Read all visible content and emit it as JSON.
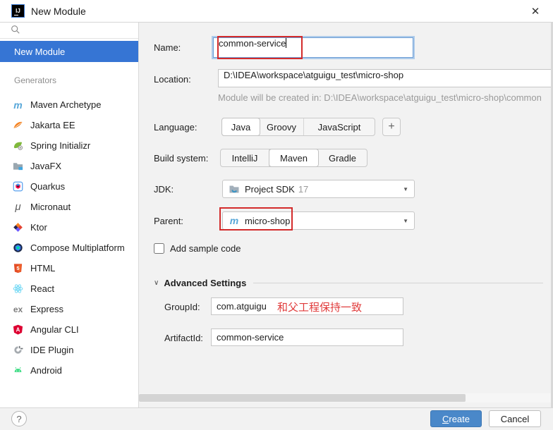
{
  "window": {
    "title": "New Module",
    "logo_text": "IJ",
    "close_glyph": "✕"
  },
  "icons": {
    "dropdown_arrow": "▼",
    "chevron_down": "∨",
    "plus": "+",
    "help": "?"
  },
  "sidebar": {
    "selected_item": "New Module",
    "section_label": "Generators",
    "generators": [
      {
        "label": "Maven Archetype",
        "icon": "maven-icon"
      },
      {
        "label": "Jakarta EE",
        "icon": "jakarta-ee-icon"
      },
      {
        "label": "Spring Initializr",
        "icon": "spring-initializr-icon"
      },
      {
        "label": "JavaFX",
        "icon": "javafx-icon"
      },
      {
        "label": "Quarkus",
        "icon": "quarkus-icon"
      },
      {
        "label": "Micronaut",
        "icon": "micronaut-icon"
      },
      {
        "label": "Ktor",
        "icon": "ktor-icon"
      },
      {
        "label": "Compose Multiplatform",
        "icon": "compose-multiplatform-icon"
      },
      {
        "label": "HTML",
        "icon": "html-icon"
      },
      {
        "label": "React",
        "icon": "react-icon"
      },
      {
        "label": "Express",
        "icon": "express-icon"
      },
      {
        "label": "Angular CLI",
        "icon": "angular-cli-icon"
      },
      {
        "label": "IDE Plugin",
        "icon": "ide-plugin-icon"
      },
      {
        "label": "Android",
        "icon": "android-icon"
      }
    ]
  },
  "form": {
    "name": {
      "label": "Name:",
      "value": "common-service"
    },
    "location": {
      "label": "Location:",
      "value": "D:\\IDEA\\workspace\\atguigu_test\\micro-shop",
      "hint": "Module will be created in: D:\\IDEA\\workspace\\atguigu_test\\micro-shop\\common"
    },
    "language": {
      "label": "Language:",
      "options": [
        "Java",
        "Groovy",
        "JavaScript"
      ],
      "selected": "Java"
    },
    "build": {
      "label": "Build system:",
      "options": [
        "IntelliJ",
        "Maven",
        "Gradle"
      ],
      "selected": "Maven"
    },
    "jdk": {
      "label": "JDK:",
      "value": "Project SDK",
      "version": "17"
    },
    "parent": {
      "label": "Parent:",
      "value": "micro-shop"
    },
    "sample": {
      "label": "Add sample code",
      "checked": false
    },
    "advanced": {
      "title": "Advanced Settings",
      "group_id": {
        "label": "GroupId:",
        "value": "com.atguigu",
        "annotation": "和父工程保持一致"
      },
      "artifact_id": {
        "label": "ArtifactId:",
        "value": "common-service"
      }
    }
  },
  "footer": {
    "create_initial": "C",
    "create_rest": "reate",
    "cancel_label": "Cancel"
  },
  "colors": {
    "selection_blue": "#3675d4",
    "create_blue": "#4a88c9",
    "highlight_red": "#d32b2b",
    "annotation_red": "#e03a3a"
  }
}
